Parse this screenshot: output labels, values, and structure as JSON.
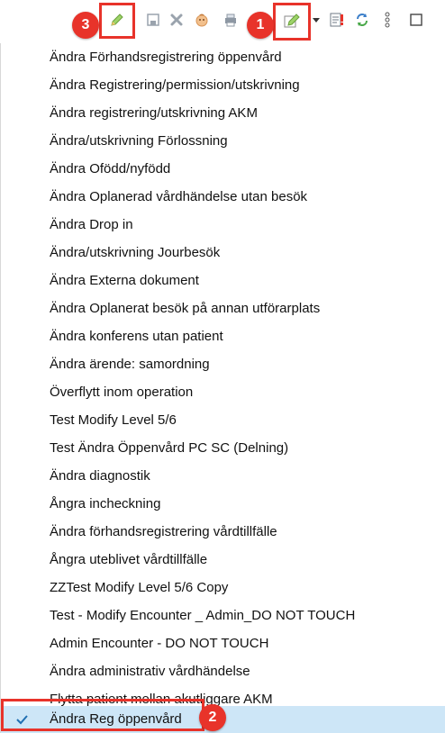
{
  "toolbar": {
    "icons": [
      "pencil-green-icon",
      "save-icon",
      "delete-x-icon",
      "patient-face-icon",
      "print-icon",
      "pencil-edit-icon",
      "dropdown-arrow-icon",
      "document-warning-icon",
      "sync-icon",
      "more-vertical-icon",
      "window-icon"
    ],
    "callouts": {
      "c1": "1",
      "c2": "2",
      "c3": "3"
    }
  },
  "menu": {
    "items": [
      "Ändra Förhandsregistrering öppenvård",
      "Ändra Registrering/permission/utskrivning",
      "Ändra registrering/utskrivning AKM",
      "Ändra/utskrivning Förlossning",
      "Ändra Ofödd/nyfödd",
      "Ändra Oplanerad vårdhändelse utan besök",
      "Ändra Drop in",
      "Ändra/utskrivning Jourbesök",
      "Ändra Externa dokument",
      "Ändra Oplanerat besök på annan utförarplats",
      "Ändra konferens utan patient",
      "Ändra ärende: samordning",
      "Överflytt inom operation",
      "Test Modify Level 5/6",
      "Test Ändra Öppenvård PC SC (Delning)",
      "Ändra diagnostik",
      "Ångra incheckning",
      "Ändra förhandsregistrering vårdtillfälle",
      "Ångra uteblivet vårdtillfälle",
      "ZZTest Modify Level 5/6 Copy",
      "Test - Modify Encounter _ Admin_DO NOT TOUCH",
      "Admin Encounter - DO NOT TOUCH",
      "Ändra administrativ vårdhändelse",
      "Flytta patient mellan akutliggare AKM",
      "Ändra Reg öppenvård"
    ],
    "selected_index": 24
  },
  "colors": {
    "callout": "#e8332a",
    "selected_row": "#cde6f7",
    "check": "#1f6fb2"
  }
}
